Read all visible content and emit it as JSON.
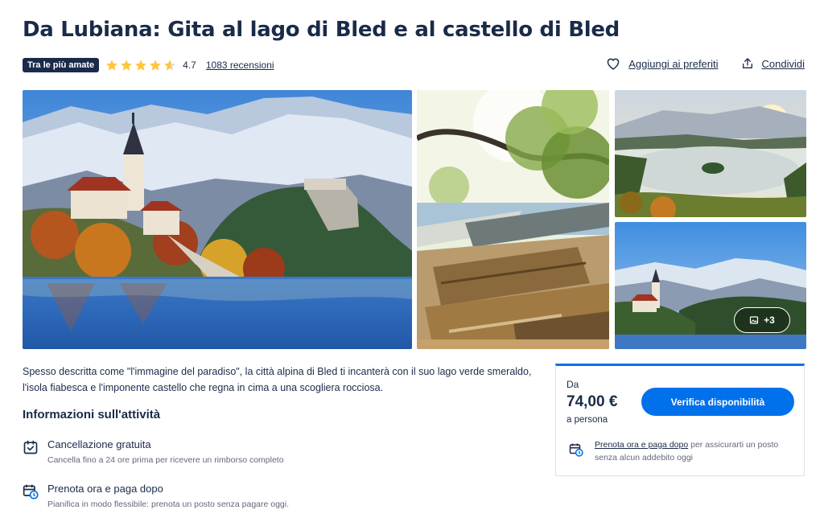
{
  "header": {
    "title": "Da Lubiana: Gita al lago di Bled e al castello di Bled",
    "badge": "Tra le più amate",
    "rating": "4.7",
    "reviews": "1083 recensioni",
    "favorite_label": "Aggiungi ai preferiti",
    "share_label": "Condividi"
  },
  "rating_stars": {
    "value": 4.7,
    "max": 5,
    "color": "#fdc73d"
  },
  "gallery": {
    "images": [
      "Lago di Bled con la chiesa sull'isola e il castello sulla scogliera",
      "Barche pletna ormeggiate sul lago",
      "Vista panoramica del lago di Bled al tramonto",
      "Chiesa sull'isola con le montagne innevate"
    ],
    "more_label": "+3"
  },
  "description": "Spesso descritta come \"l'immagine del paradiso\", la città alpina di Bled ti incanterà con il suo lago verde smeraldo, l'isola fiabesca e l'imponente castello che regna in cima a una scogliera rocciosa.",
  "info": {
    "title": "Informazioni sull'attività",
    "features": [
      {
        "icon": "calendar-check-icon",
        "title": "Cancellazione gratuita",
        "subtitle": "Cancella fino a 24 ore prima per ricevere un rimborso completo"
      },
      {
        "icon": "calendar-clock-icon",
        "title": "Prenota ora e paga dopo",
        "subtitle": "Pianifica in modo flessibile: prenota un posto senza pagare oggi."
      }
    ]
  },
  "booking": {
    "from_label": "Da",
    "price": "74,00 €",
    "per_label": "a persona",
    "button": "Verifica disponibilità",
    "note_link": "Prenota ora e paga dopo",
    "note_text": " per assicurarti un posto senza alcun addebito oggi"
  },
  "colors": {
    "primary": "#0071eb",
    "navy": "#1a2b49",
    "muted": "#63687a",
    "star": "#fdc73d"
  }
}
